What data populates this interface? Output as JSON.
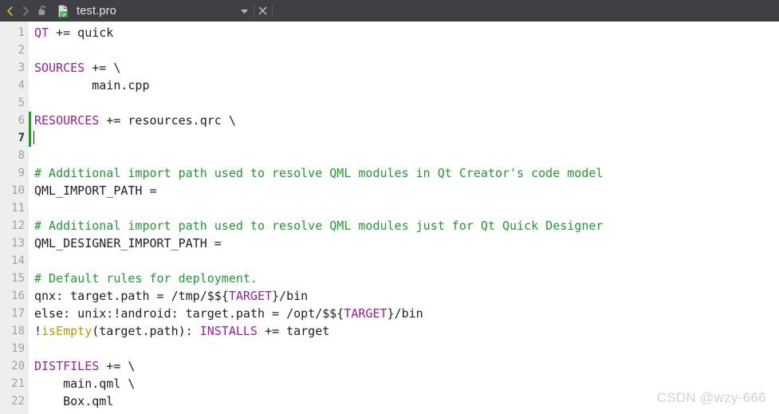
{
  "tabbar": {
    "back_label": "‹",
    "forward_label": "›",
    "lock_name": "unlocked",
    "file_icon_badge": "Qt",
    "title": "test.pro",
    "dropdown_label": "▾",
    "close_label": "✕",
    "colors": {
      "background": "#3f3f46",
      "back_arrow": "#d8b32c",
      "forward_arrow": "#7d7d84",
      "title_text": "#e8e8ea"
    }
  },
  "editor": {
    "language": "qmake",
    "current_line": 7,
    "modified_lines": [
      6,
      7
    ],
    "colors": {
      "background": "#ffffff",
      "gutter": "#eeeeee",
      "line_number": "#a0a0a0",
      "keyword": "#9b1f9b",
      "comment": "#1f9b2f",
      "function": "#b59b00",
      "text": "#202020",
      "change_marker": "#1e9e1e"
    },
    "lines": [
      {
        "n": "1",
        "tokens": [
          {
            "t": "QT",
            "c": "kw"
          },
          {
            "t": " += quick",
            "c": "op"
          }
        ]
      },
      {
        "n": "2",
        "tokens": []
      },
      {
        "n": "3",
        "tokens": [
          {
            "t": "SOURCES",
            "c": "kw"
          },
          {
            "t": " += \\",
            "c": "op"
          }
        ]
      },
      {
        "n": "4",
        "tokens": [
          {
            "t": "        main.cpp",
            "c": "op"
          }
        ]
      },
      {
        "n": "5",
        "tokens": []
      },
      {
        "n": "6",
        "tokens": [
          {
            "t": "RESOURCES",
            "c": "kw"
          },
          {
            "t": " += resources.qrc \\",
            "c": "op"
          }
        ]
      },
      {
        "n": "7",
        "tokens": [],
        "caret": true
      },
      {
        "n": "8",
        "tokens": []
      },
      {
        "n": "9",
        "tokens": [
          {
            "t": "# Additional import path used to resolve QML modules in Qt Creator's code model",
            "c": "cmt"
          }
        ]
      },
      {
        "n": "10",
        "tokens": [
          {
            "t": "QML_IMPORT_PATH =",
            "c": "op"
          }
        ]
      },
      {
        "n": "11",
        "tokens": []
      },
      {
        "n": "12",
        "tokens": [
          {
            "t": "# Additional import path used to resolve QML modules just for Qt Quick Designer",
            "c": "cmt"
          }
        ]
      },
      {
        "n": "13",
        "tokens": [
          {
            "t": "QML_DESIGNER_IMPORT_PATH =",
            "c": "op"
          }
        ]
      },
      {
        "n": "14",
        "tokens": []
      },
      {
        "n": "15",
        "tokens": [
          {
            "t": "# Default rules for deployment.",
            "c": "cmt"
          }
        ]
      },
      {
        "n": "16",
        "tokens": [
          {
            "t": "qnx: target.path = /tmp/$${",
            "c": "op"
          },
          {
            "t": "TARGET",
            "c": "kw"
          },
          {
            "t": "}/bin",
            "c": "op"
          }
        ]
      },
      {
        "n": "17",
        "tokens": [
          {
            "t": "else: unix:!android: target.path = /opt/$${",
            "c": "op"
          },
          {
            "t": "TARGET",
            "c": "kw"
          },
          {
            "t": "}/bin",
            "c": "op"
          }
        ]
      },
      {
        "n": "18",
        "tokens": [
          {
            "t": "!",
            "c": "op"
          },
          {
            "t": "isEmpty",
            "c": "fn"
          },
          {
            "t": "(target.path): ",
            "c": "op"
          },
          {
            "t": "INSTALLS",
            "c": "kw"
          },
          {
            "t": " += target",
            "c": "op"
          }
        ]
      },
      {
        "n": "19",
        "tokens": []
      },
      {
        "n": "20",
        "tokens": [
          {
            "t": "DISTFILES",
            "c": "kw"
          },
          {
            "t": " += \\",
            "c": "op"
          }
        ]
      },
      {
        "n": "21",
        "tokens": [
          {
            "t": "    main.qml \\",
            "c": "op"
          }
        ]
      },
      {
        "n": "22",
        "tokens": [
          {
            "t": "    Box.qml",
            "c": "op"
          }
        ]
      }
    ]
  },
  "watermark": {
    "text": "CSDN @wzy-666"
  }
}
